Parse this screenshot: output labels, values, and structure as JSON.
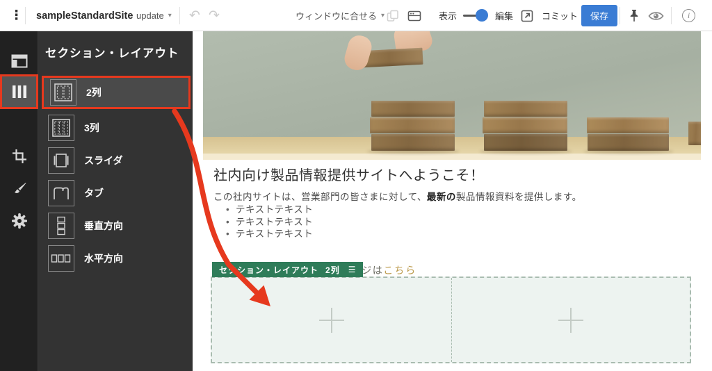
{
  "toolbar": {
    "site_name": "sampleStandardSite",
    "update_label": "update",
    "fit_window_label": "ウィンドウに合せる",
    "display_label": "表示",
    "edit_label": "編集",
    "commit_label": "コミット",
    "save_label": "保存"
  },
  "icons": {
    "kebab": "⋮",
    "undo": "↶",
    "redo": "↷",
    "caret": "▾",
    "menu": "☰",
    "info": "i"
  },
  "sidebar": {
    "title": "セクション・レイアウト",
    "items": [
      {
        "label": "2列",
        "selected": true
      },
      {
        "label": "3列",
        "selected": false
      },
      {
        "label": "スライダ",
        "selected": false
      },
      {
        "label": "タブ",
        "selected": false
      },
      {
        "label": "垂直方向",
        "selected": false
      },
      {
        "label": "水平方向",
        "selected": false
      }
    ]
  },
  "content": {
    "heading": "社内向け製品情報提供サイトへようこそ！",
    "paragraph_prefix": "この社内サイトは、営業部門の皆さまに対して、",
    "paragraph_bold": "最新の",
    "paragraph_suffix": "製品情報資料を提供します。",
    "bullets": [
      "テキストテキスト",
      "テキストテキスト",
      "テキストテキスト"
    ],
    "partial_text": "ージは",
    "partial_link": "こちら",
    "section_tag": {
      "name": "セクション・レイアウト",
      "type": "2列"
    }
  },
  "colors": {
    "accent_red": "#e6391e",
    "primary_blue": "#3a7cd4",
    "tag_green": "#2f7c59",
    "link_gold": "#bd9b4d",
    "dropzone_bg": "#edf3f0"
  }
}
